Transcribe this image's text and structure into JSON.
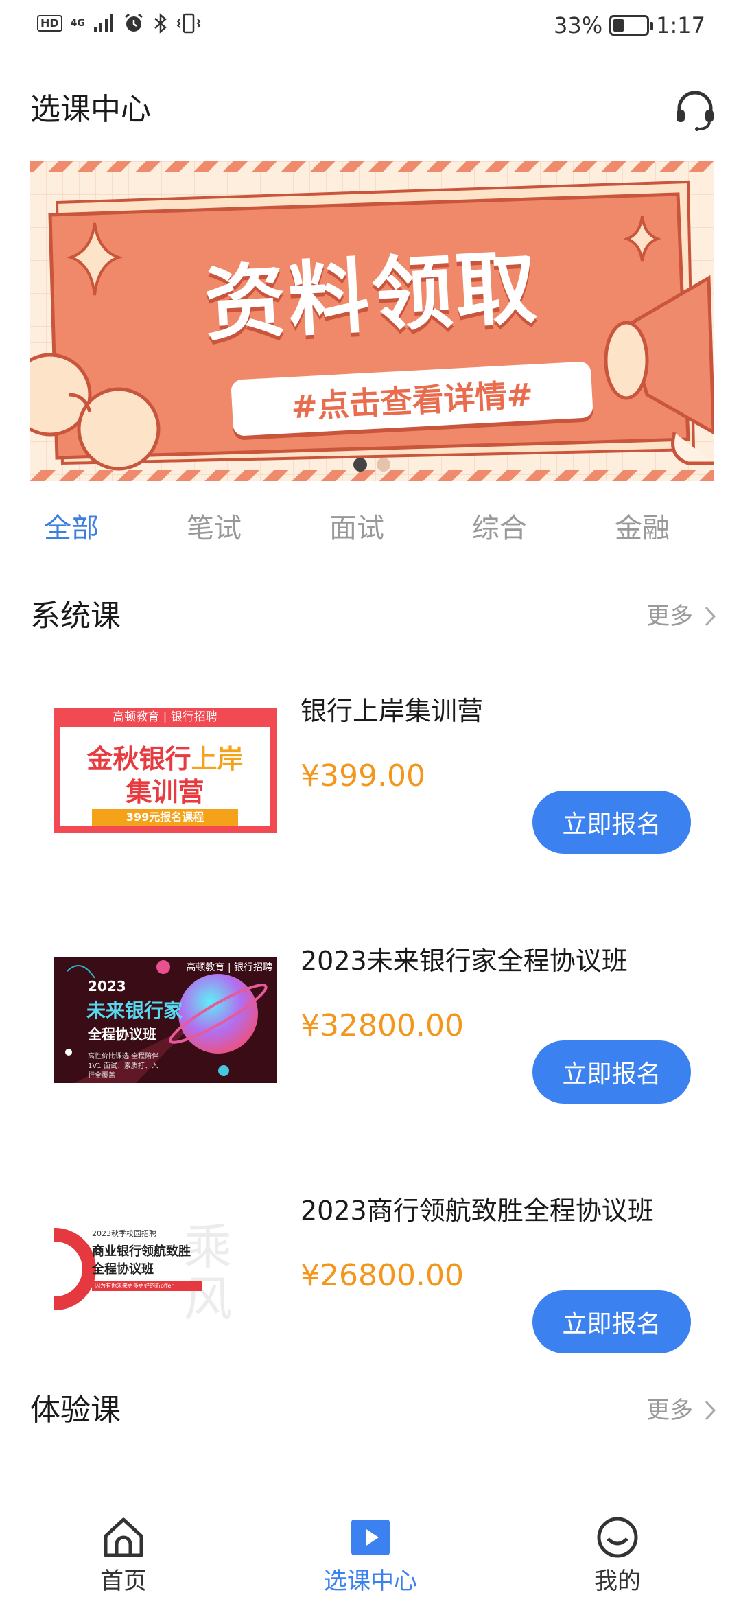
{
  "status_bar": {
    "hd": "HD",
    "network": "4G",
    "battery_percent": "33%",
    "battery_level": 0.33,
    "time": "1:17"
  },
  "header": {
    "title": "选课中心",
    "support_icon": "headset-icon"
  },
  "banner": {
    "title": "资料领取",
    "subtitle": "#点击查看详情#",
    "slide_count": 2,
    "active_slide": 0
  },
  "tabs": [
    {
      "label": "全部",
      "active": true
    },
    {
      "label": "笔试",
      "active": false
    },
    {
      "label": "面试",
      "active": false
    },
    {
      "label": "综合",
      "active": false
    },
    {
      "label": "金融",
      "active": false
    }
  ],
  "sections": {
    "system": {
      "title": "系统课",
      "more": "更多"
    },
    "trial": {
      "title": "体验课",
      "more": "更多"
    }
  },
  "courses": [
    {
      "name": "银行上岸集训营",
      "price": "¥399.00",
      "button": "立即报名",
      "thumb": {
        "brand": "高顿教育 | 银行招聘",
        "line1a": "金秋银行",
        "line1b": "上岸",
        "line2": "集训营",
        "line3": "399元报名课程"
      }
    },
    {
      "name": "2023未来银行家全程协议班",
      "price": "¥32800.00",
      "button": "立即报名",
      "thumb": {
        "brand": "高顿教育 | 银行招聘",
        "year": "2023",
        "line1": "未来银行家",
        "line2": "全程协议班",
        "line3": "高性价比课选 全程陪伴1V1 面试、素质打、入行全覆盖"
      }
    },
    {
      "name": "2023商行领航致胜全程协议班",
      "price": "¥26800.00",
      "button": "立即报名",
      "thumb": {
        "year": "2023秋季校园招聘",
        "line1": "商业银行领航致胜",
        "line2": "全程协议班",
        "line3": "因为有你未来更多更好的新offer",
        "callig": "乘风"
      }
    }
  ],
  "bottom_nav": [
    {
      "label": "首页",
      "icon": "home-icon",
      "active": false
    },
    {
      "label": "选课中心",
      "icon": "play-course-icon",
      "active": true
    },
    {
      "label": "我的",
      "icon": "smile-profile-icon",
      "active": false
    }
  ],
  "colors": {
    "accent": "#3b82f0",
    "price": "#f2961c",
    "banner": "#f0896a"
  }
}
